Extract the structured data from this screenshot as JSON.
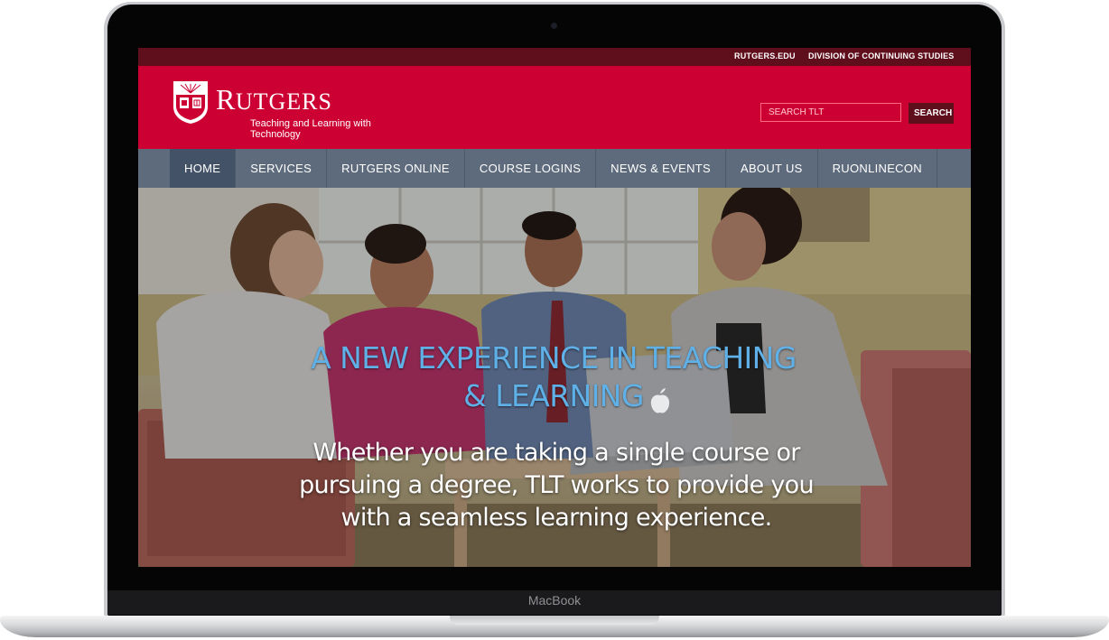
{
  "device": {
    "brand_label": "MacBook"
  },
  "utility_nav": {
    "links": [
      "RUTGERS.EDU",
      "DIVISION OF CONTINUING STUDIES"
    ]
  },
  "header": {
    "wordmark": "Rutgers",
    "tagline": "Teaching and Learning with Technology",
    "search": {
      "placeholder": "SEARCH TLT",
      "button_label": "SEARCH"
    }
  },
  "main_nav": {
    "items": [
      "HOME",
      "SERVICES",
      "RUTGERS ONLINE",
      "COURSE LOGINS",
      "NEWS & EVENTS",
      "ABOUT US",
      "RUONLINECON"
    ],
    "active": "HOME"
  },
  "hero": {
    "title": "A NEW EXPERIENCE IN TEACHING & LEARNING",
    "subtitle": "Whether you are taking a single course or pursuing a degree, TLT works to provide you with a seamless learning experience."
  },
  "colors": {
    "brand_red": "#cc0033",
    "utility_bar": "#5f0e1b",
    "nav_bar": "#5e6b7d",
    "nav_active": "#435267",
    "hero_title": "#5fb0e6"
  },
  "icons": [
    "camera-icon",
    "rutgers-shield-icon",
    "apple-logo-icon"
  ]
}
